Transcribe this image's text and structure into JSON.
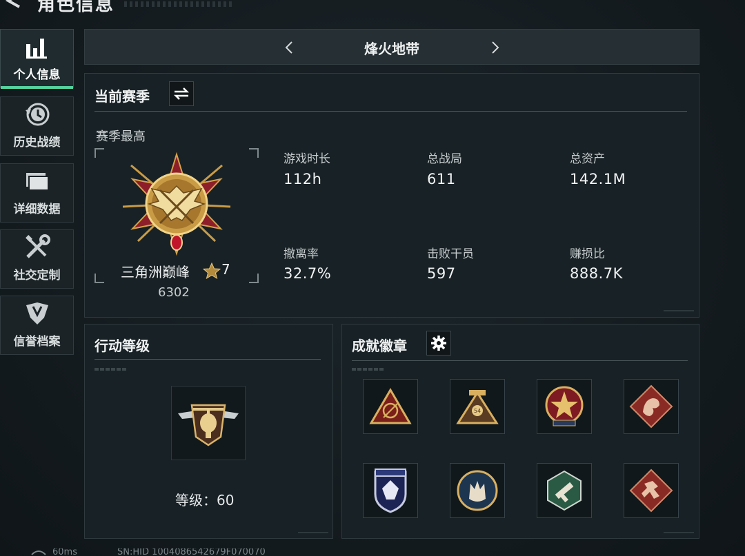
{
  "header": {
    "title": "角色信息"
  },
  "sidebar": {
    "items": [
      {
        "label": "个人信息",
        "icon": "bar-chart-icon",
        "active": true
      },
      {
        "label": "历史战绩",
        "icon": "history-clock-icon",
        "active": false
      },
      {
        "label": "详细数据",
        "icon": "folder-icon",
        "active": false
      },
      {
        "label": "社交定制",
        "icon": "wrench-screwdriver-icon",
        "active": false
      },
      {
        "label": "信誉档案",
        "icon": "shield-emblem-icon",
        "active": false
      }
    ]
  },
  "mode": {
    "title": "烽火地带"
  },
  "season": {
    "title": "当前赛季",
    "best_label": "赛季最高",
    "rank_name": "三角洲巅峰",
    "rank_stars": "7",
    "rank_score": "6302",
    "stats": [
      {
        "label": "游戏时长",
        "value": "112h"
      },
      {
        "label": "总战局",
        "value": "611"
      },
      {
        "label": "总资产",
        "value": "142.1M"
      },
      {
        "label": "撤离率",
        "value": "32.7%"
      },
      {
        "label": "击败干员",
        "value": "597"
      },
      {
        "label": "赚损比",
        "value": "888.7K"
      }
    ]
  },
  "action_level": {
    "title": "行动等级",
    "level_text": "等级：60"
  },
  "achievements": {
    "title": "成就徽章",
    "badges": [
      "triangle-compass-badge",
      "triangle-54-badge",
      "star-medal-badge",
      "dragon-diamond-badge",
      "shield-crystal-badge",
      "wolf-circle-badge",
      "hexagon-gun-badge",
      "runner-diamond-badge"
    ]
  },
  "footer": {
    "ping": "60ms",
    "sn": "SN:HID 1004086542679F070070"
  },
  "colors": {
    "accent": "#55d39e",
    "background": "#141c20",
    "panel": "#182125"
  }
}
